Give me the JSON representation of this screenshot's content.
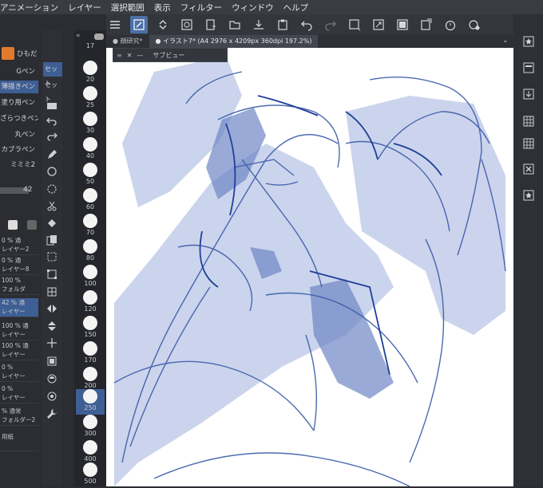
{
  "menubar": {
    "items": [
      "アニメーション",
      "レイヤー",
      "選択範囲",
      "表示",
      "フィルター",
      "ウィンドウ",
      "ヘルプ"
    ]
  },
  "subtool_panel": {
    "header_label": "ひもだ",
    "items": [
      "Gペン",
      "薄描きペン",
      "塗り用ペン",
      "ざらつきペン",
      "丸ペン",
      "カブラペン",
      "ミミミ2"
    ],
    "selected_index": 1,
    "brush_size_value": "42",
    "set_labels": [
      "セット",
      "セット"
    ]
  },
  "layers": [
    {
      "opacity": "0 %",
      "mode": "通",
      "name": "レイヤー2"
    },
    {
      "opacity": "0 %",
      "mode": "通",
      "name": "レイヤー8"
    },
    {
      "opacity": "100 %",
      "mode": "",
      "name": "フォルダ"
    },
    {
      "opacity": "42 %",
      "mode": "通",
      "name": "レイヤー"
    },
    {
      "opacity": "100 %",
      "mode": "通",
      "name": "レイヤー"
    },
    {
      "opacity": "100 %",
      "mode": "通",
      "name": "レイヤー"
    },
    {
      "opacity": "0 %",
      "mode": "",
      "name": "レイヤー"
    },
    {
      "opacity": "0 %",
      "mode": "",
      "name": "レイヤー"
    },
    {
      "opacity": "% 通常",
      "mode": "",
      "name": "フォルダー2"
    },
    {
      "opacity": "",
      "mode": "",
      "name": "用紙"
    }
  ],
  "brush_sizes": [
    "17",
    "20",
    "25",
    "30",
    "40",
    "50",
    "60",
    "70",
    "80",
    "100",
    "120",
    "150",
    "170",
    "200",
    "250",
    "300",
    "400",
    "500"
  ],
  "selected_brush_size": "250",
  "tabs": [
    {
      "label": "顔研究*",
      "selected": false
    },
    {
      "label": "イラスト7* (A4 2976 x 4209px 360dpi 197.2%)",
      "selected": true
    }
  ],
  "subview": {
    "title": "サブビュー"
  },
  "colors": {
    "accent": "#3e5f94",
    "sketch_blue": "#3a5aa8",
    "sketch_fill": "#b9c6e6"
  },
  "icons": {
    "toolbar": [
      "menu-icon",
      "brush-edit-icon",
      "stepper-icon",
      "stabilizer-icon",
      "new-file-icon",
      "open-folder-icon",
      "save-icon",
      "clipboard-icon",
      "undo-icon",
      "redo-icon",
      "crop-icon",
      "transform-icon",
      "fill-icon",
      "export-icon",
      "timer-icon",
      "settings-icon"
    ],
    "right": [
      "star-icon",
      "layer-panel-icon",
      "download-icon",
      "grid-icon",
      "grid2-icon",
      "close-box-icon",
      "star2-icon"
    ]
  }
}
